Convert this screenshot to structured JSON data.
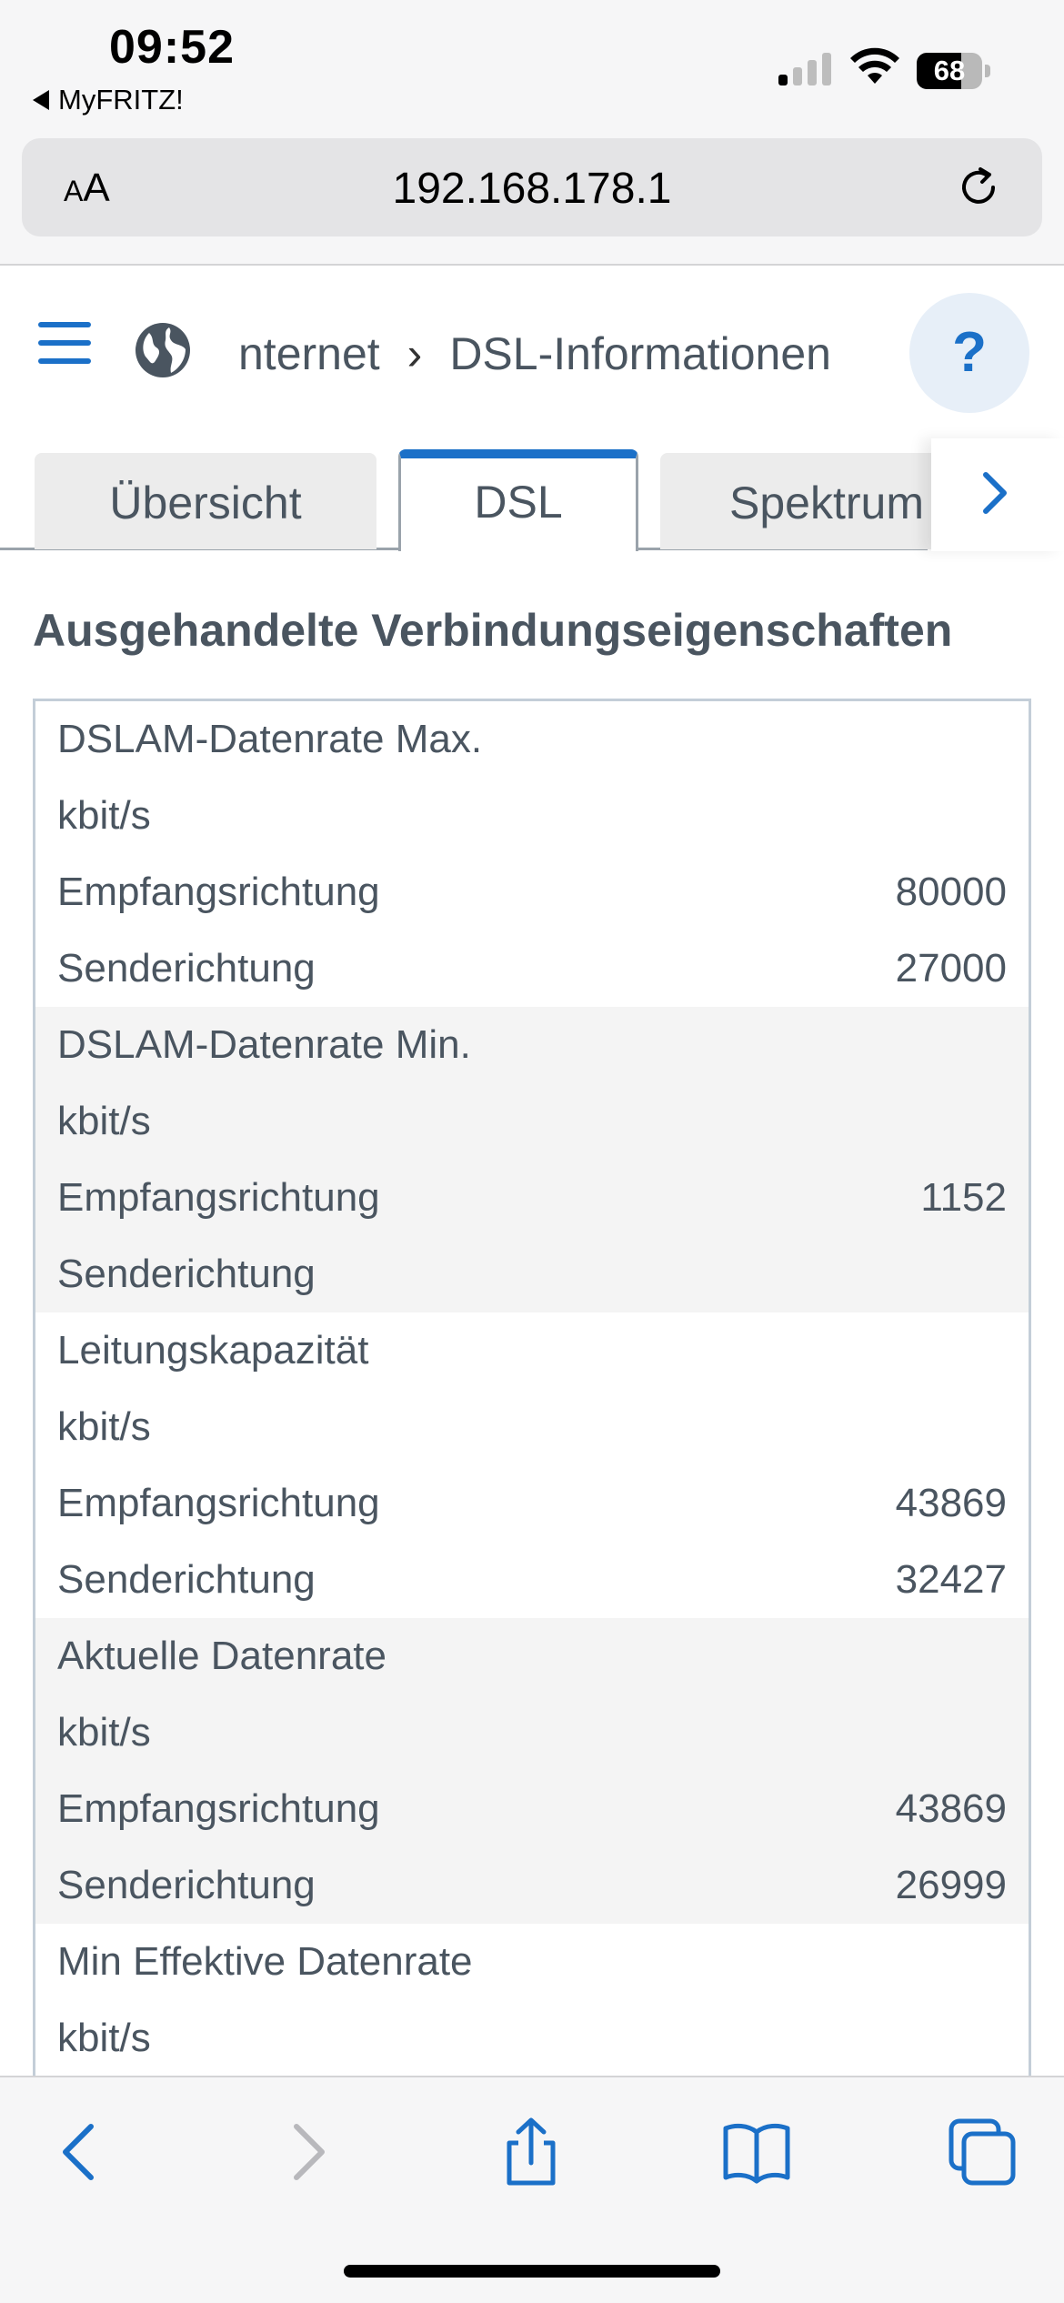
{
  "status_bar": {
    "time": "09:52",
    "back_app": "MyFRITZ!",
    "battery_percent": "68",
    "battery_level": 0.68,
    "signal_bars_active": 1
  },
  "browser": {
    "aa_label_small": "A",
    "aa_label_large": "A",
    "url": "192.168.178.1"
  },
  "header": {
    "breadcrumb_parent": "nternet",
    "breadcrumb_separator": "›",
    "breadcrumb_current": "DSL-Informationen",
    "help_label": "?"
  },
  "tabs": [
    {
      "label": "Übersicht",
      "active": false
    },
    {
      "label": "DSL",
      "active": true
    },
    {
      "label": "Spektrum",
      "active": false
    }
  ],
  "section_title": "Ausgehandelte Verbindungseigenschaften",
  "groups": [
    {
      "title": "DSLAM-Datenrate Max.",
      "unit": "kbit/s",
      "rows": [
        {
          "label": "Empfangsrichtung",
          "value": "80000"
        },
        {
          "label": "Senderichtung",
          "value": "27000"
        }
      ]
    },
    {
      "title": "DSLAM-Datenrate Min.",
      "unit": "kbit/s",
      "rows": [
        {
          "label": "Empfangsrichtung",
          "value": "1152"
        },
        {
          "label": "Senderichtung",
          "value": ""
        }
      ]
    },
    {
      "title": "Leitungskapazität",
      "unit": "kbit/s",
      "rows": [
        {
          "label": "Empfangsrichtung",
          "value": "43869"
        },
        {
          "label": "Senderichtung",
          "value": "32427"
        }
      ]
    },
    {
      "title": "Aktuelle Datenrate",
      "unit": "kbit/s",
      "rows": [
        {
          "label": "Empfangsrichtung",
          "value": "43869"
        },
        {
          "label": "Senderichtung",
          "value": "26999"
        }
      ]
    },
    {
      "title": "Min Effektive Datenrate",
      "unit": "kbit/s",
      "rows": []
    }
  ],
  "colors": {
    "accent": "#1b70c8",
    "text": "#4a5560",
    "row_shade": "#f4f4f4",
    "border": "#c3ced8"
  },
  "toolbar_icons": [
    "back-icon",
    "forward-icon",
    "share-icon",
    "bookmarks-icon",
    "tabs-icon"
  ]
}
